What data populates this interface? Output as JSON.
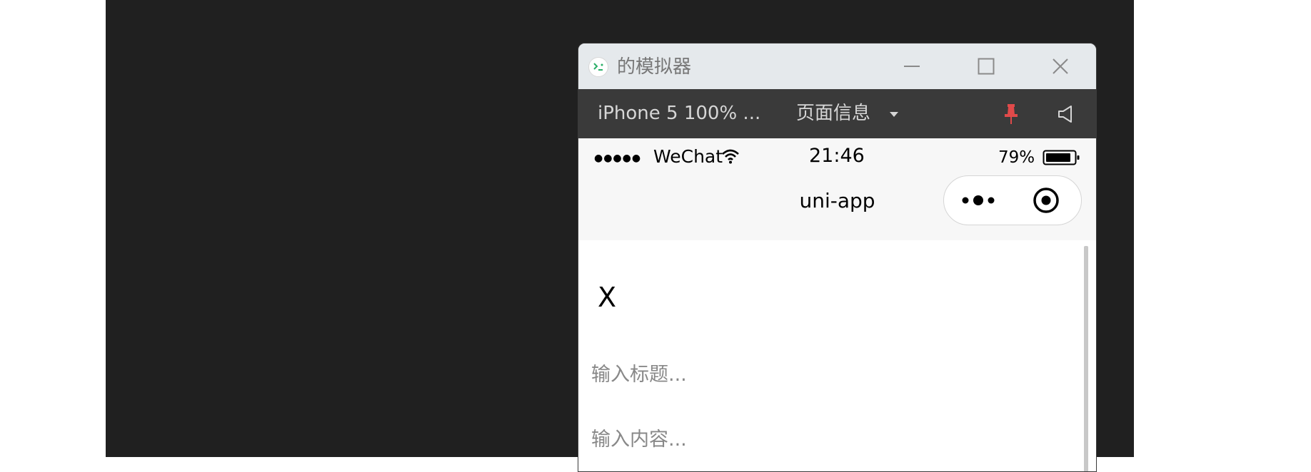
{
  "window": {
    "title": "的模拟器"
  },
  "toolbar": {
    "device": "iPhone 5 100% ...",
    "page_info": "页面信息"
  },
  "statusbar": {
    "signal": "●●●●●",
    "carrier": "WeChat",
    "time": "21:46",
    "battery": "79%"
  },
  "navbar": {
    "title": "uni-app"
  },
  "page": {
    "close_label": "X",
    "title_placeholder": "输入标题...",
    "content_placeholder": "输入内容..."
  },
  "colors": {
    "background": "#202020",
    "titlebar": "#e5e9ec",
    "toolbar": "#3a3a3a",
    "pin": "#e04a4a",
    "phone_bar": "#f7f7f7"
  }
}
